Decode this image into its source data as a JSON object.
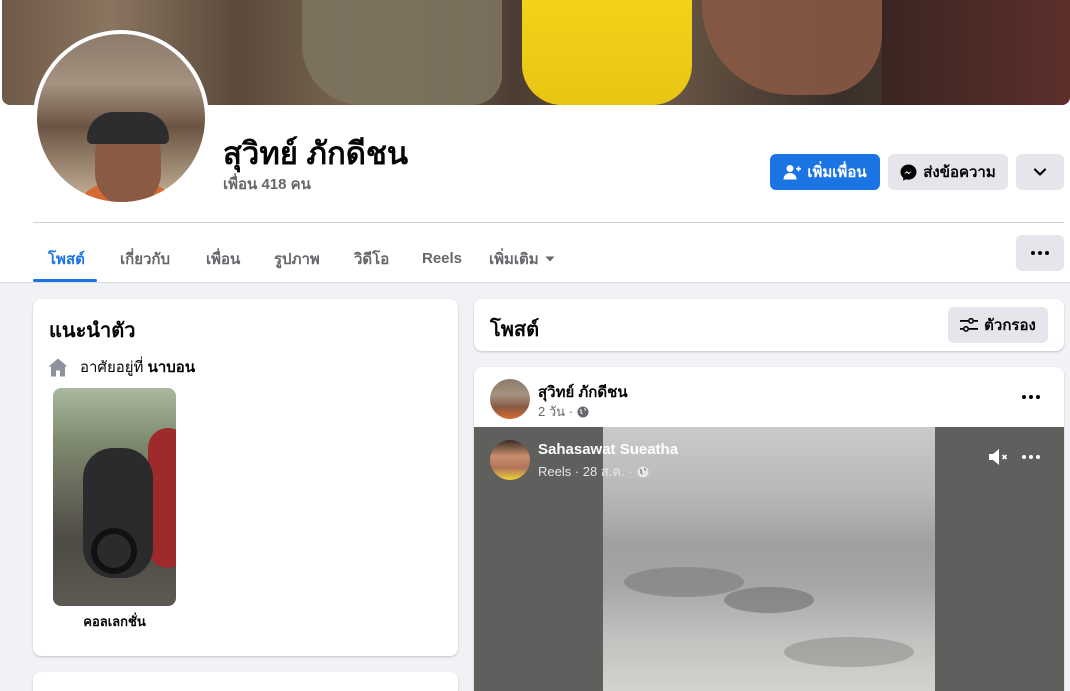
{
  "profile": {
    "name": "สุวิทย์ ภักดีชน",
    "friends_count": "เพื่อน 418 คน"
  },
  "actions": {
    "add_friend": "เพิ่มเพื่อน",
    "message": "ส่งข้อความ"
  },
  "tabs": [
    {
      "label": "โพสต์"
    },
    {
      "label": "เกี่ยวกับ"
    },
    {
      "label": "เพื่อน"
    },
    {
      "label": "รูปภาพ"
    },
    {
      "label": "วิดีโอ"
    },
    {
      "label": "Reels"
    },
    {
      "label": "เพิ่มเติม"
    }
  ],
  "intro": {
    "title": "แนะนำตัว",
    "lives_in_prefix": "อาศัยอยู่ที่",
    "lives_in_place": "นาบอน",
    "collection_caption": "คอลเลกชั่น"
  },
  "posts_header": {
    "title": "โพสต์",
    "filter_label": "ตัวกรอง"
  },
  "post": {
    "author": "สุวิทย์ ภักดีชน",
    "time": "2 วัน ·",
    "reel": {
      "author": "Sahasawat Sueatha",
      "meta": "Reels · 28 ส.ค. ·"
    }
  },
  "colors": {
    "accent": "#1b74e4",
    "secondary_text": "#65676b",
    "background": "#f0f2f5"
  }
}
